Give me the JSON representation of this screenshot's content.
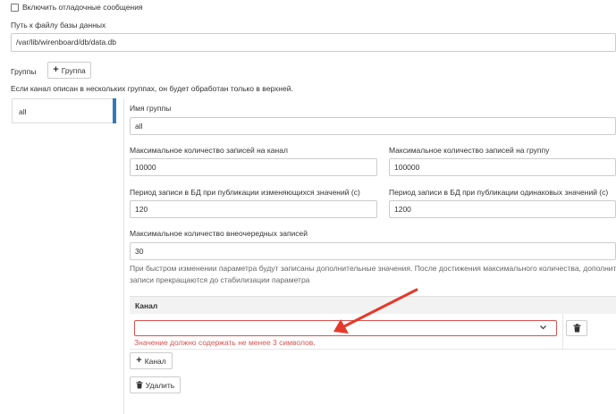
{
  "debug": {
    "label": "Включить отладочные сообщения"
  },
  "db_path": {
    "label": "Путь к файлу базы данных",
    "value": "/var/lib/wirenboard/db/data.db"
  },
  "groups": {
    "heading": "Группы",
    "add_label": "Группа",
    "note": "Если канал описан в нескольких группах, он будет обработан только в верхней.",
    "list": [
      "all"
    ]
  },
  "group_form": {
    "name_label": "Имя группы",
    "name_value": "all",
    "max_records_channel_label": "Максимальное количество записей на канал",
    "max_records_channel_value": "10000",
    "max_records_group_label": "Максимальное количество записей на группу",
    "max_records_group_value": "100000",
    "period_changing_label": "Период записи в БД при публикации изменяющихся значений (с)",
    "period_changing_value": "120",
    "period_same_label": "Период записи в БД при публикации одинаковых значений (с)",
    "period_same_value": "1200",
    "max_unscheduled_label": "Максимальное количество внеочередных записей",
    "max_unscheduled_value": "30",
    "help_line1": "При быстром изменении параметра будут записаны дополнительные значения. После достижения максимального количества, дополнительные",
    "help_line2": "записи прекращаются до стабилизации параметра",
    "channel_header": "Канал",
    "channel_value": "",
    "channel_error": "Значение должно содержать не менее 3 символов.",
    "add_channel_label": "Канал",
    "delete_label": "Удалить"
  },
  "colors": {
    "accent": "#337ab7",
    "error": "#d9534f",
    "arrow": "#e53a2b"
  },
  "icons": [
    "plus-icon",
    "chevron-down-icon",
    "trash-icon",
    "arrow-annotation"
  ]
}
